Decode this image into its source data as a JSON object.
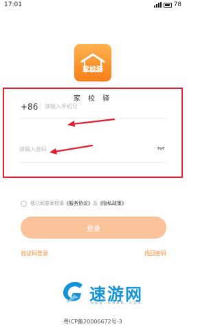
{
  "status_bar": {
    "time": "17:01",
    "battery": "78"
  },
  "logo": {
    "text": "家校驿"
  },
  "app": {
    "title": "家 校 驿"
  },
  "login_form": {
    "country_code": "+86",
    "phone_placeholder": "请输入手机号",
    "password_placeholder": "请输入密码"
  },
  "agreement": {
    "prefix": "我已同意家校驿",
    "service_link": "《服务协议》",
    "and": "及",
    "privacy_link": "《隐私政策》"
  },
  "login_button": "登录",
  "links": {
    "sms_login": "验证码登录",
    "forgot_password": "找回密码"
  },
  "watermark": {
    "text": "速游网",
    "url": "www.6686.com"
  },
  "footer": {
    "icp": "粤ICP备20006672号-3"
  },
  "colors": {
    "accent": "#f08a2e",
    "button": "#fbc39b",
    "annotation": "#e01e2d",
    "watermark": "#1593d8"
  }
}
